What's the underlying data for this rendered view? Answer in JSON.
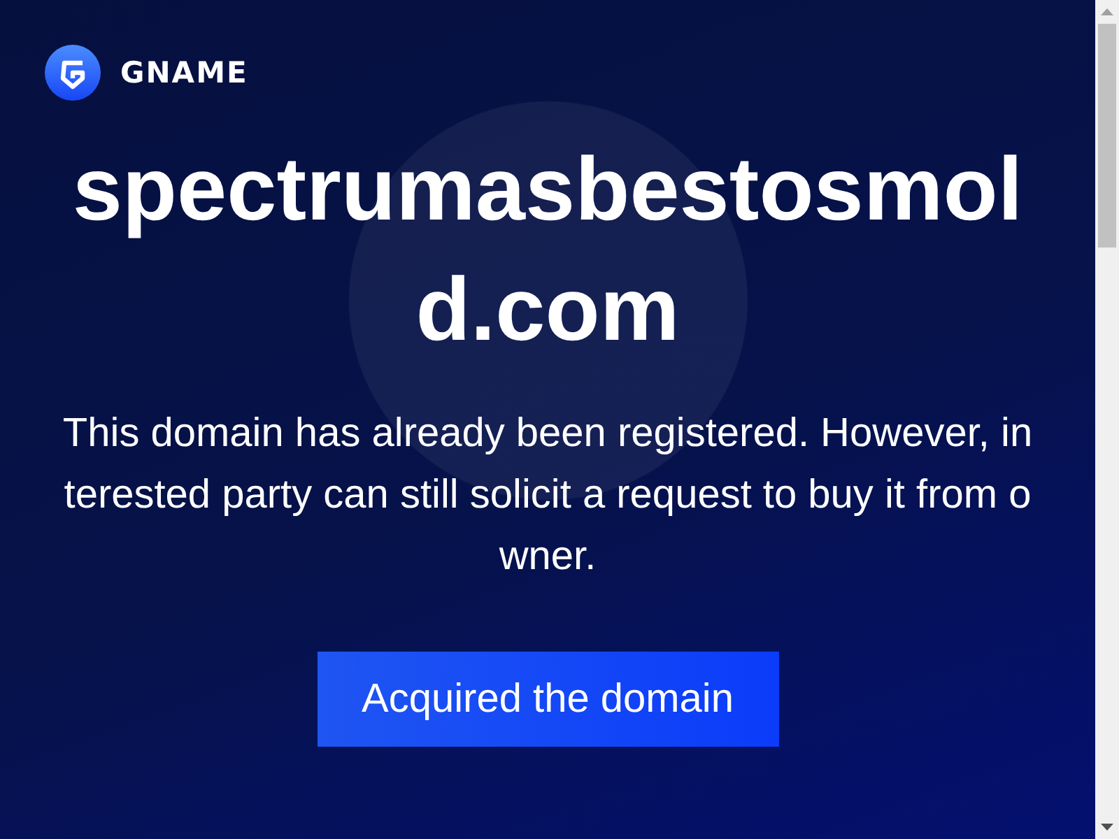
{
  "brand": {
    "name": "GNAME"
  },
  "domain": "spectrumasbestosmold.com",
  "message": "This domain has already been registered. However, interested party can still solicit a request to buy it from owner.",
  "button": "Acquired the domain"
}
